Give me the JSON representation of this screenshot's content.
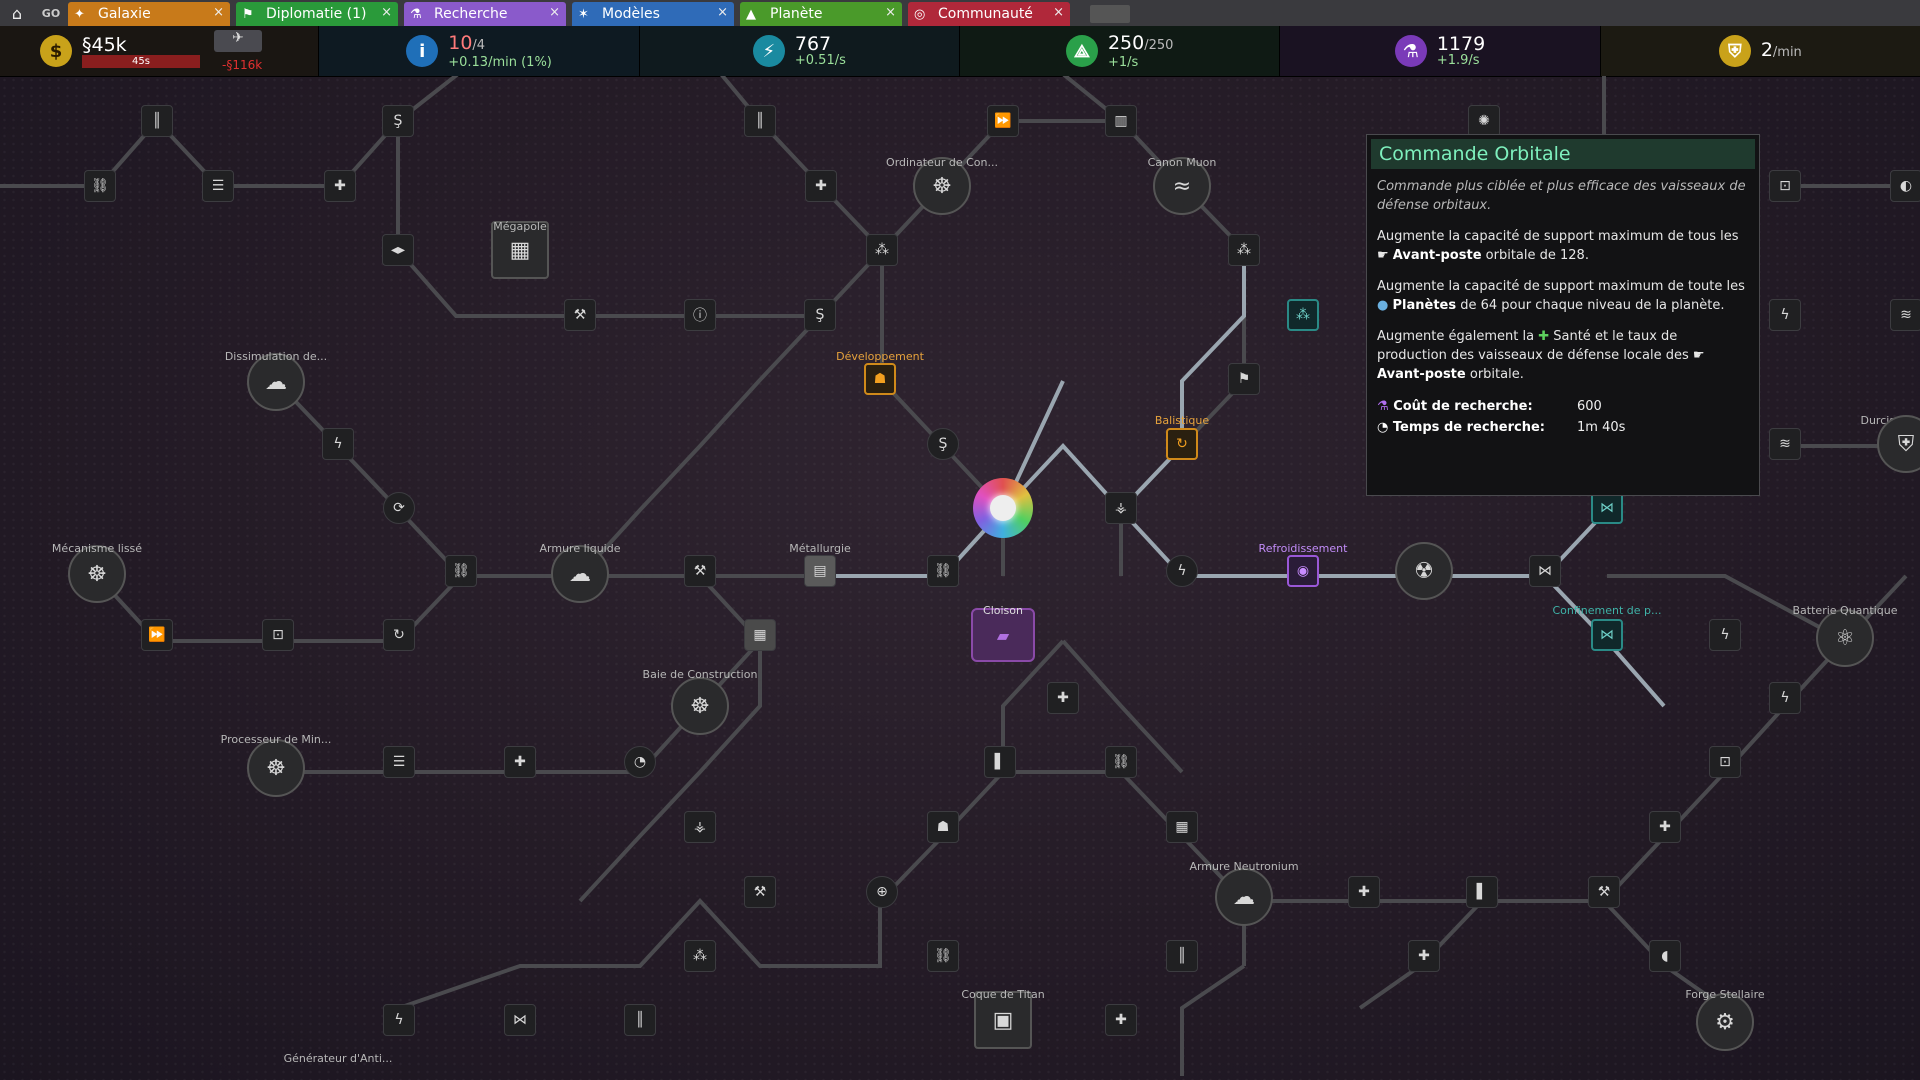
{
  "tabs": [
    {
      "label": "Galaxie",
      "icon": "galaxy-icon",
      "color": "#c87a1a"
    },
    {
      "label": "Diplomatie (1)",
      "icon": "diplomacy-icon",
      "color": "#2a9a3a"
    },
    {
      "label": "Recherche",
      "icon": "research-icon",
      "color": "#8a5acb"
    },
    {
      "label": "Modèles",
      "icon": "designs-icon",
      "color": "#2f6bb8"
    },
    {
      "label": "Planète",
      "icon": "planet-icon",
      "color": "#4a9a2a"
    },
    {
      "label": "Communauté",
      "icon": "community-icon",
      "color": "#b0283a"
    }
  ],
  "tabbar": {
    "go": "GO",
    "home_icon": "home-icon",
    "close": "×"
  },
  "resources": {
    "money": {
      "value": "§45k",
      "timer": "45s",
      "debt": "-§116k"
    },
    "influence": {
      "value": "10",
      "cap": "/4",
      "rate": "+0.13/min (1%)"
    },
    "energy": {
      "value": "767",
      "rate": "+0.51/s"
    },
    "ftl": {
      "value": "250",
      "cap": "/250",
      "rate": "+1/s"
    },
    "research": {
      "value": "1179",
      "rate": "+1.9/s"
    },
    "defense": {
      "value": "2",
      "unit": "/min"
    }
  },
  "labels": {
    "megapole": "Mégapole",
    "ordinateur": "Ordinateur de Con...",
    "canon_muon": "Canon Muon",
    "dissimulation": "Dissimulation de...",
    "developpement": "Développement",
    "balistique": "Balistique",
    "mecanisme": "Mécanisme lissé",
    "armure_liquide": "Armure liquide",
    "metallurgie": "Métallurgie",
    "refroidissement": "Refroidissement",
    "cloison": "Cloison",
    "confinement": "Confinement de p...",
    "batterie": "Batterie Quantique",
    "durcisseur": "Durcisseur b",
    "baie": "Baie de Construction",
    "processeur": "Processeur de Min...",
    "armure_neutronium": "Armure Neutronium",
    "coque_titan": "Coque de Titan",
    "forge": "Forge Stellaire",
    "generateur": "Générateur d'Anti..."
  },
  "tooltip": {
    "title": "Commande Orbitale",
    "description": "Commande plus ciblée et plus efficace des vaisseaux de défense orbitaux.",
    "p1_a": "Augmente la capacité de support maximum de tous les",
    "p1_b": "Avant-poste",
    "p1_c": "orbitale de 128.",
    "p2_a": "Augmente la capacité de support maximum de toute les",
    "p2_b": "Planètes",
    "p2_c": "de 64 pour chaque niveau de la planète.",
    "p3_a": "Augmente également la",
    "p3_b": "Santé",
    "p3_c": "et le taux de production des vaisseaux de défense locale des",
    "p3_d": "Avant-poste",
    "p3_e": "orbitale.",
    "cost_label": "Coût de recherche:",
    "cost_value": "600",
    "time_label": "Temps de recherche:",
    "time_value": "1m 40s"
  }
}
